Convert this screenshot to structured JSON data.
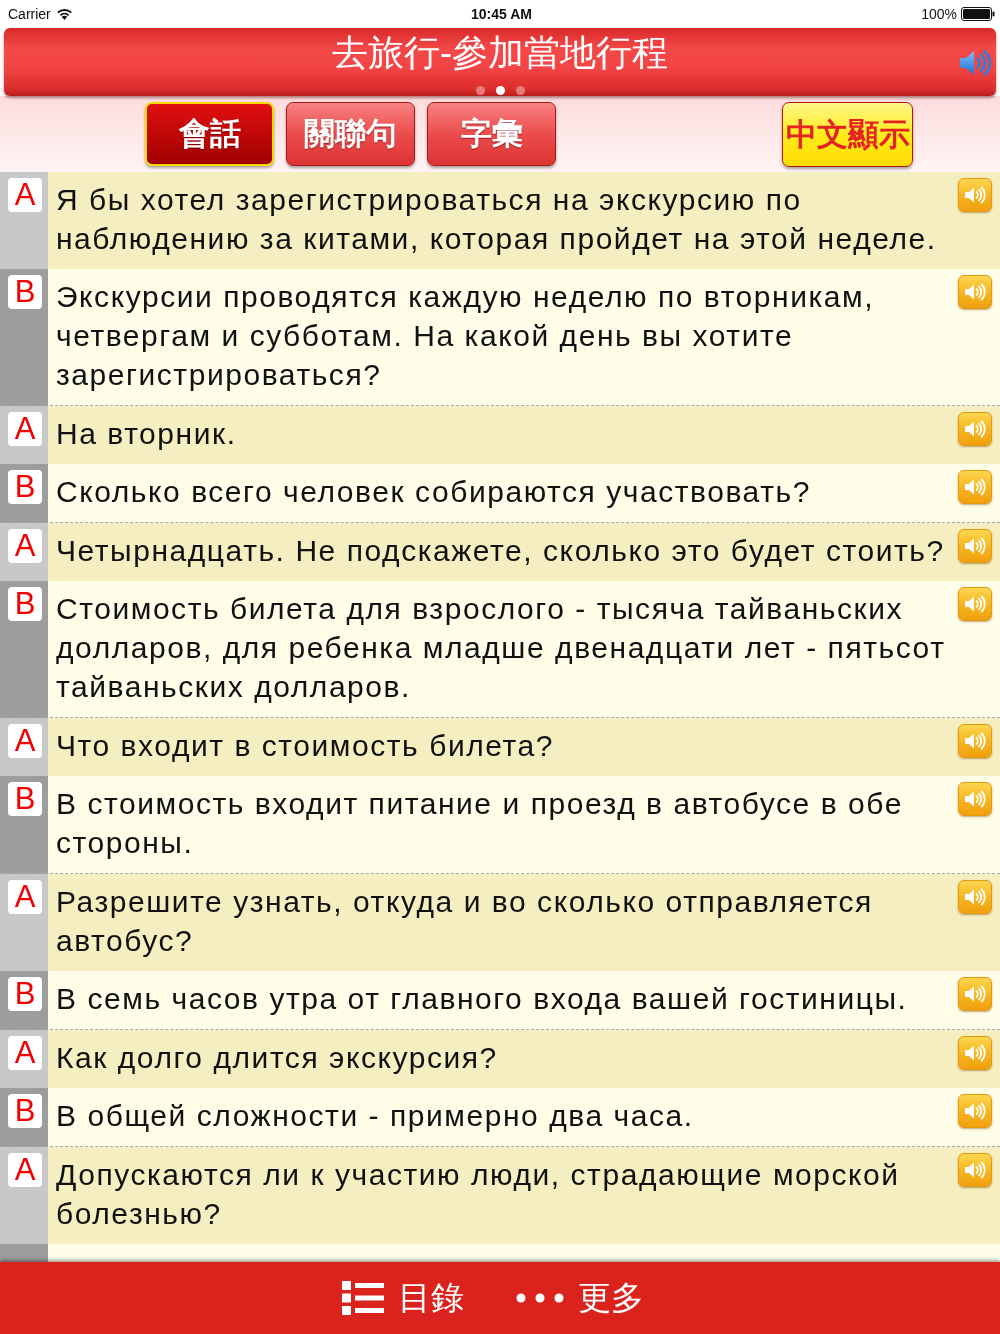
{
  "status_bar": {
    "carrier": "Carrier",
    "time": "10:45 AM",
    "battery": "100%"
  },
  "header": {
    "title": "去旅行-參加當地行程",
    "pages": [
      {
        "selected": false
      },
      {
        "selected": true
      },
      {
        "selected": false
      }
    ]
  },
  "tabs": [
    {
      "label": "會話",
      "selected": true
    },
    {
      "label": "關聯句",
      "selected": false
    },
    {
      "label": "字彙",
      "selected": false
    }
  ],
  "display_toggle": {
    "label": "中文顯示"
  },
  "dialogue": [
    {
      "speaker": "A",
      "kind": "shaded",
      "text": "Я бы хотел зарегистрироваться на экскурсию по наблюдению за китами, которая пройдет на этой неделе."
    },
    {
      "speaker": "B",
      "kind": "plain",
      "text": "Экскурсии проводятся каждую неделю по вторникам, четвергам и субботам. На какой день вы хотите зарегистрироваться?"
    },
    {
      "speaker": "A",
      "kind": "shaded",
      "text": "На вторник."
    },
    {
      "speaker": "B",
      "kind": "plain",
      "text": "Сколько всего человек собираются участвовать?"
    },
    {
      "speaker": "A",
      "kind": "shaded",
      "text": "Четырнадцать. Не подскажете, сколько это будет стоить?"
    },
    {
      "speaker": "B",
      "kind": "plain",
      "text": "Стоимость билета для взрослого - тысяча тайваньских долларов, для ребенка младше двенадцати лет - пятьсот тайваньских долларов."
    },
    {
      "speaker": "A",
      "kind": "shaded",
      "text": "Что входит в стоимость билета?"
    },
    {
      "speaker": "B",
      "kind": "plain",
      "text": "В стоимость входит питание и проезд в автобусе в обе стороны."
    },
    {
      "speaker": "A",
      "kind": "shaded",
      "text": "Разрешите узнать, откуда и во сколько отправляется автобус?"
    },
    {
      "speaker": "B",
      "kind": "plain",
      "text": "В семь часов утра от главного входа вашей гостиницы."
    },
    {
      "speaker": "A",
      "kind": "shaded",
      "text": "Как долго длится экскурсия?"
    },
    {
      "speaker": "B",
      "kind": "plain",
      "text": "В общей сложности - примерно два часа."
    },
    {
      "speaker": "A",
      "kind": "shaded",
      "text": "Допускаются ли к участию люди, страдающие морской болезнью?"
    }
  ],
  "bottom_bar": [
    {
      "label": "目錄",
      "kind": "list"
    },
    {
      "label": "更多",
      "kind": "more"
    }
  ]
}
